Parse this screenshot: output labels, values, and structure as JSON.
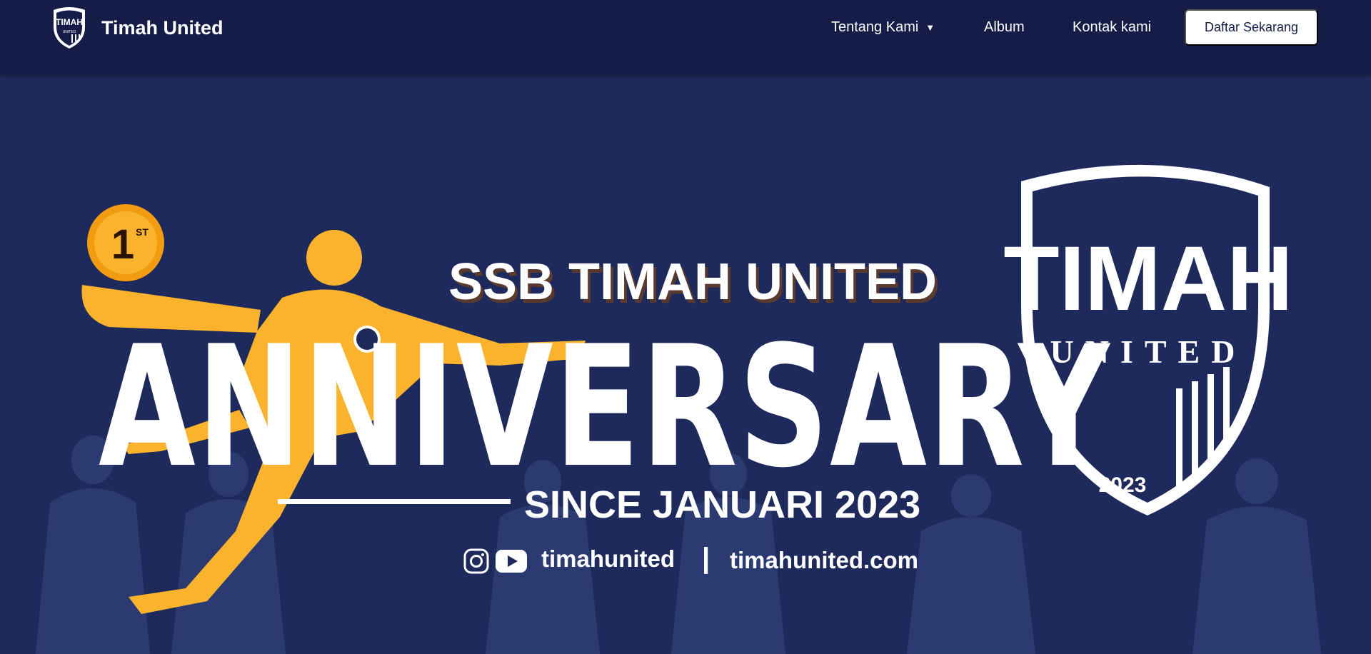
{
  "header": {
    "brand_name": "Timah United",
    "logo_text_top": "TIMAH",
    "logo_text_bottom": "UNITED"
  },
  "nav": {
    "items": [
      {
        "label": "Tentang Kami",
        "has_dropdown": true
      },
      {
        "label": "Album"
      },
      {
        "label": "Kontak kami"
      }
    ],
    "cta_label": "Daftar Sekarang"
  },
  "hero": {
    "subtitle": "SSB TIMAH UNITED",
    "title": "ANNIVERSARY",
    "since": "SINCE JANUARI 2023",
    "badge_text": "1",
    "badge_sup": "ST",
    "social_handle": "timahunited",
    "separator": "|",
    "website": "timahunited.com",
    "crest_top": "TIMAH",
    "crest_middle": "UNITED",
    "crest_year": "2023",
    "icons": [
      "instagram-icon",
      "youtube-icon"
    ]
  },
  "colors": {
    "navbar_bg": "#141c47",
    "hero_bg": "#1e2a5c",
    "accent_gold": "#fbb32d",
    "text_white": "#ffffff"
  }
}
